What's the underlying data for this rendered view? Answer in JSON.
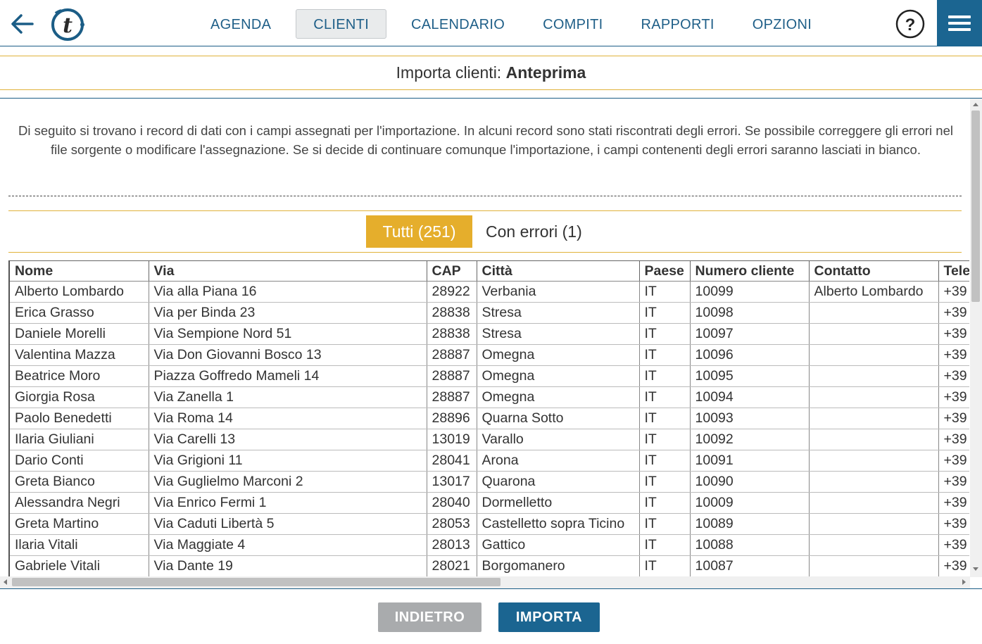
{
  "nav": {
    "items": [
      {
        "label": "AGENDA",
        "active": false
      },
      {
        "label": "CLIENTI",
        "active": true
      },
      {
        "label": "CALENDARIO",
        "active": false
      },
      {
        "label": "COMPITI",
        "active": false
      },
      {
        "label": "RAPPORTI",
        "active": false
      },
      {
        "label": "OPZIONI",
        "active": false
      }
    ],
    "help_label": "?"
  },
  "page": {
    "title_prefix": "Importa clienti: ",
    "title_bold": "Anteprima",
    "description": "Di seguito si trovano i record di dati con i campi assegnati per l'importazione. In alcuni record sono stati riscontrati degli errori. Se possibile correggere gli errori nel file sorgente o modificare l'assegnazione. Se si decide di continuare comunque l'importazione, i campi contenenti degli errori saranno lasciati in bianco."
  },
  "filters": {
    "all_label": "Tutti (251)",
    "errors_label": "Con errori (1)"
  },
  "table": {
    "columns": [
      "Nome",
      "Via",
      "CAP",
      "Città",
      "Paese",
      "Numero cliente",
      "Contatto",
      "Tele"
    ],
    "rows": [
      [
        "Alberto Lombardo",
        "Via alla Piana 16",
        "28922",
        "Verbania",
        "IT",
        "10099",
        "Alberto Lombardo",
        "+39"
      ],
      [
        "Erica Grasso",
        "Via per Binda 23",
        "28838",
        "Stresa",
        "IT",
        "10098",
        "",
        "+39"
      ],
      [
        "Daniele Morelli",
        "Via Sempione Nord 51",
        "28838",
        "Stresa",
        "IT",
        "10097",
        "",
        "+39"
      ],
      [
        "Valentina Mazza",
        "Via Don Giovanni Bosco 13",
        "28887",
        "Omegna",
        "IT",
        "10096",
        "",
        "+39"
      ],
      [
        "Beatrice Moro",
        "Piazza Goffredo Mameli 14",
        "28887",
        "Omegna",
        "IT",
        "10095",
        "",
        "+39"
      ],
      [
        "Giorgia Rosa",
        "Via Zanella 1",
        "28887",
        "Omegna",
        "IT",
        "10094",
        "",
        "+39"
      ],
      [
        "Paolo Benedetti",
        "Via Roma 14",
        "28896",
        "Quarna Sotto",
        "IT",
        "10093",
        "",
        "+39"
      ],
      [
        "Ilaria Giuliani",
        "Via Carelli 13",
        "13019",
        "Varallo",
        "IT",
        "10092",
        "",
        "+39"
      ],
      [
        "Dario Conti",
        "Via Grigioni 11",
        "28041",
        "Arona",
        "IT",
        "10091",
        "",
        "+39"
      ],
      [
        "Greta Bianco",
        "Via Guglielmo Marconi 2",
        "13017",
        "Quarona",
        "IT",
        "10090",
        "",
        "+39"
      ],
      [
        "Alessandra Negri",
        "Via Enrico Fermi 1",
        "28040",
        "Dormelletto",
        "IT",
        "10009",
        "",
        "+39"
      ],
      [
        "Greta Martino",
        "Via Caduti Libertà 5",
        "28053",
        "Castelletto sopra Ticino",
        "IT",
        "10089",
        "",
        "+39"
      ],
      [
        "Ilaria Vitali",
        "Via Maggiate 4",
        "28013",
        "Gattico",
        "IT",
        "10088",
        "",
        "+39"
      ],
      [
        "Gabriele Vitali",
        "Via Dante 19",
        "28021",
        "Borgomanero",
        "IT",
        "10087",
        "",
        "+39"
      ]
    ]
  },
  "footer": {
    "back_label": "INDIETRO",
    "import_label": "IMPORTA"
  },
  "colors": {
    "brand_blue": "#1b6591",
    "accent_gold": "#e5ae2c",
    "disabled_gray": "#a9abad"
  },
  "icons": {
    "back": "arrow-left-icon",
    "logo": "t-logo-icon",
    "help": "question-circle-icon",
    "menu": "hamburger-menu-icon"
  }
}
